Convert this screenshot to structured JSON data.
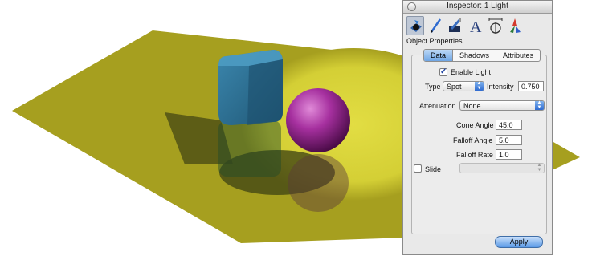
{
  "scene": {
    "plane_color": "#a69f1f",
    "spot_color": "#d8d43a",
    "cube_color": "#2b6f92",
    "sphere_color": "#9a2f94"
  },
  "inspector": {
    "title": "Inspector:  1 Light",
    "section_label": "Object Properties",
    "tools": [
      "geometry-icon",
      "pen-icon",
      "style-icon",
      "text-icon",
      "measure-icon",
      "colors-icon"
    ],
    "tabs": [
      {
        "label": "Data",
        "active": true
      },
      {
        "label": "Shadows",
        "active": false
      },
      {
        "label": "Attributes",
        "active": false
      }
    ],
    "enable_light": {
      "label": "Enable Light",
      "checked": true
    },
    "type": {
      "label": "Type",
      "value": "Spot"
    },
    "intensity": {
      "label": "Intensity",
      "value": "0.750"
    },
    "attenuation": {
      "label": "Attenuation",
      "value": "None"
    },
    "cone_angle": {
      "label": "Cone Angle",
      "value": "45.0"
    },
    "falloff_angle": {
      "label": "Falloff Angle",
      "value": "5.0"
    },
    "falloff_rate": {
      "label": "Falloff Rate",
      "value": "1.0"
    },
    "slide": {
      "label": "Slide",
      "checked": false,
      "value": ""
    },
    "apply_label": "Apply"
  }
}
